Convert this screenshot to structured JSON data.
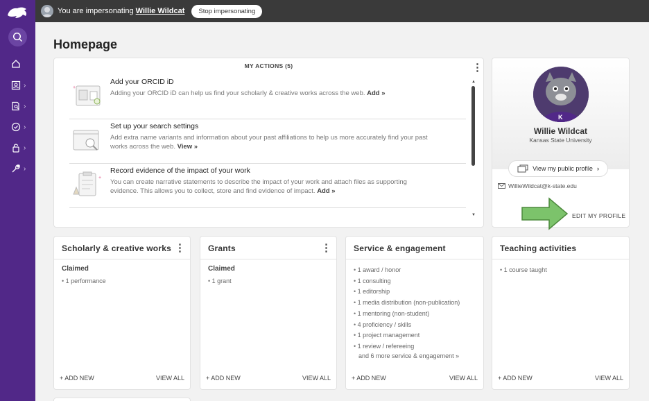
{
  "topbar": {
    "impersonating_text": "You are impersonating",
    "user_name": "Willie Wildcat",
    "stop_button": "Stop impersonating"
  },
  "page": {
    "title": "Homepage"
  },
  "actions": {
    "title": "MY ACTIONS (5)",
    "items": [
      {
        "title": "Add your ORCID iD",
        "desc": "Adding your ORCID iD can help us find your scholarly & creative works across the web.",
        "link": "Add »"
      },
      {
        "title": "Set up your search settings",
        "desc": "Add extra name variants and information about your past affiliations to help us more accurately find your past works across the web.",
        "link": "View »"
      },
      {
        "title": "Record evidence of the impact of your work",
        "desc": "You can create narrative statements to describe the impact of your work and attach files as supporting evidence. This allows you to collect, store and find evidence of impact.",
        "link": "Add »"
      }
    ]
  },
  "profile": {
    "name": "Willie Wildcat",
    "org": "Kansas State University",
    "public_button": "View my public profile",
    "email": "WillieWildcat@k-state.edu",
    "edit_link": "EDIT MY PROFILE"
  },
  "boxes": [
    {
      "title": "Scholarly & creative works",
      "sub": "Claimed",
      "items": [
        "1 performance"
      ],
      "more": "",
      "add": "+ ADD NEW",
      "view": "VIEW ALL"
    },
    {
      "title": "Grants",
      "sub": "Claimed",
      "items": [
        "1 grant"
      ],
      "more": "",
      "add": "+ ADD NEW",
      "view": "VIEW ALL"
    },
    {
      "title": "Service & engagement",
      "sub": "",
      "items": [
        "1 award / honor",
        "1 consulting",
        "1 editorship",
        "1 media distribution (non-publication)",
        "1 mentoring (non-student)",
        "4 proficiency / skills",
        "1 project management",
        "1 review / refereeing"
      ],
      "more": "and 6 more service & engagement »",
      "add": "+ ADD NEW",
      "view": "VIEW ALL"
    },
    {
      "title": "Teaching activities",
      "sub": "",
      "items": [
        "1 course taught"
      ],
      "more": "",
      "add": "+ ADD NEW",
      "view": "VIEW ALL"
    }
  ],
  "colors": {
    "sidebar": "#512888",
    "topbar": "#3a3a3a",
    "arrow": "#7cc36b"
  }
}
